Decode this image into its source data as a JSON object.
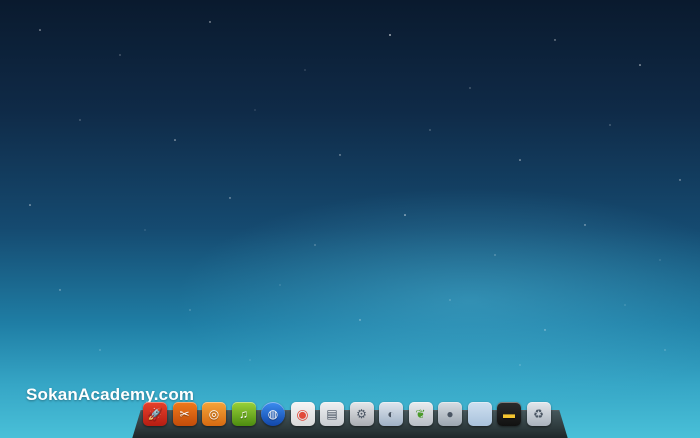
{
  "watermark": {
    "text": "SokanAcademy.com"
  },
  "dock": {
    "items": [
      {
        "name": "rocket-icon",
        "glyph": "🚀",
        "bg": "#e8412c",
        "bg2": "#b51d12"
      },
      {
        "name": "scissors-icon",
        "glyph": "✂",
        "bg": "#f07a1c",
        "bg2": "#c24c0a"
      },
      {
        "name": "spiral-icon",
        "glyph": "◎",
        "bg": "#f6a53a",
        "bg2": "#d66a11"
      },
      {
        "name": "music-note-icon",
        "glyph": "♫",
        "bg": "#9ad23a",
        "bg2": "#4c8c10"
      },
      {
        "name": "globe-icon",
        "glyph": "◍",
        "bg": "#3c8df0",
        "bg2": "#1146a8"
      },
      {
        "name": "chrome-icon",
        "glyph": "◉",
        "bg": "#f5f5f5",
        "bg2": "#d9d9d9"
      },
      {
        "name": "folder-icon",
        "glyph": "▤",
        "bg": "#eef0f2",
        "bg2": "#c8ccd1"
      },
      {
        "name": "settings-icon",
        "glyph": "⚙",
        "bg": "#e5e7ea",
        "bg2": "#a9adb3"
      },
      {
        "name": "browser-icon",
        "glyph": "◐",
        "bg": "#dfe6ee",
        "bg2": "#9fb1c6"
      },
      {
        "name": "leaf-icon",
        "glyph": "❦",
        "bg": "#e9ecef",
        "bg2": "#b8bec5"
      },
      {
        "name": "camera-lens-icon",
        "glyph": "●",
        "bg": "#d7dde3",
        "bg2": "#9ca6b0"
      },
      {
        "name": "blank-window-icon",
        "glyph": "",
        "bg": "#cfe0f0",
        "bg2": "#a9c2dc"
      },
      {
        "name": "terminal-icon",
        "glyph": "▬",
        "bg": "#2b2b2b",
        "bg2": "#111111"
      },
      {
        "name": "trash-icon",
        "glyph": "♻",
        "bg": "#e3e7ec",
        "bg2": "#aab3bd"
      }
    ]
  }
}
